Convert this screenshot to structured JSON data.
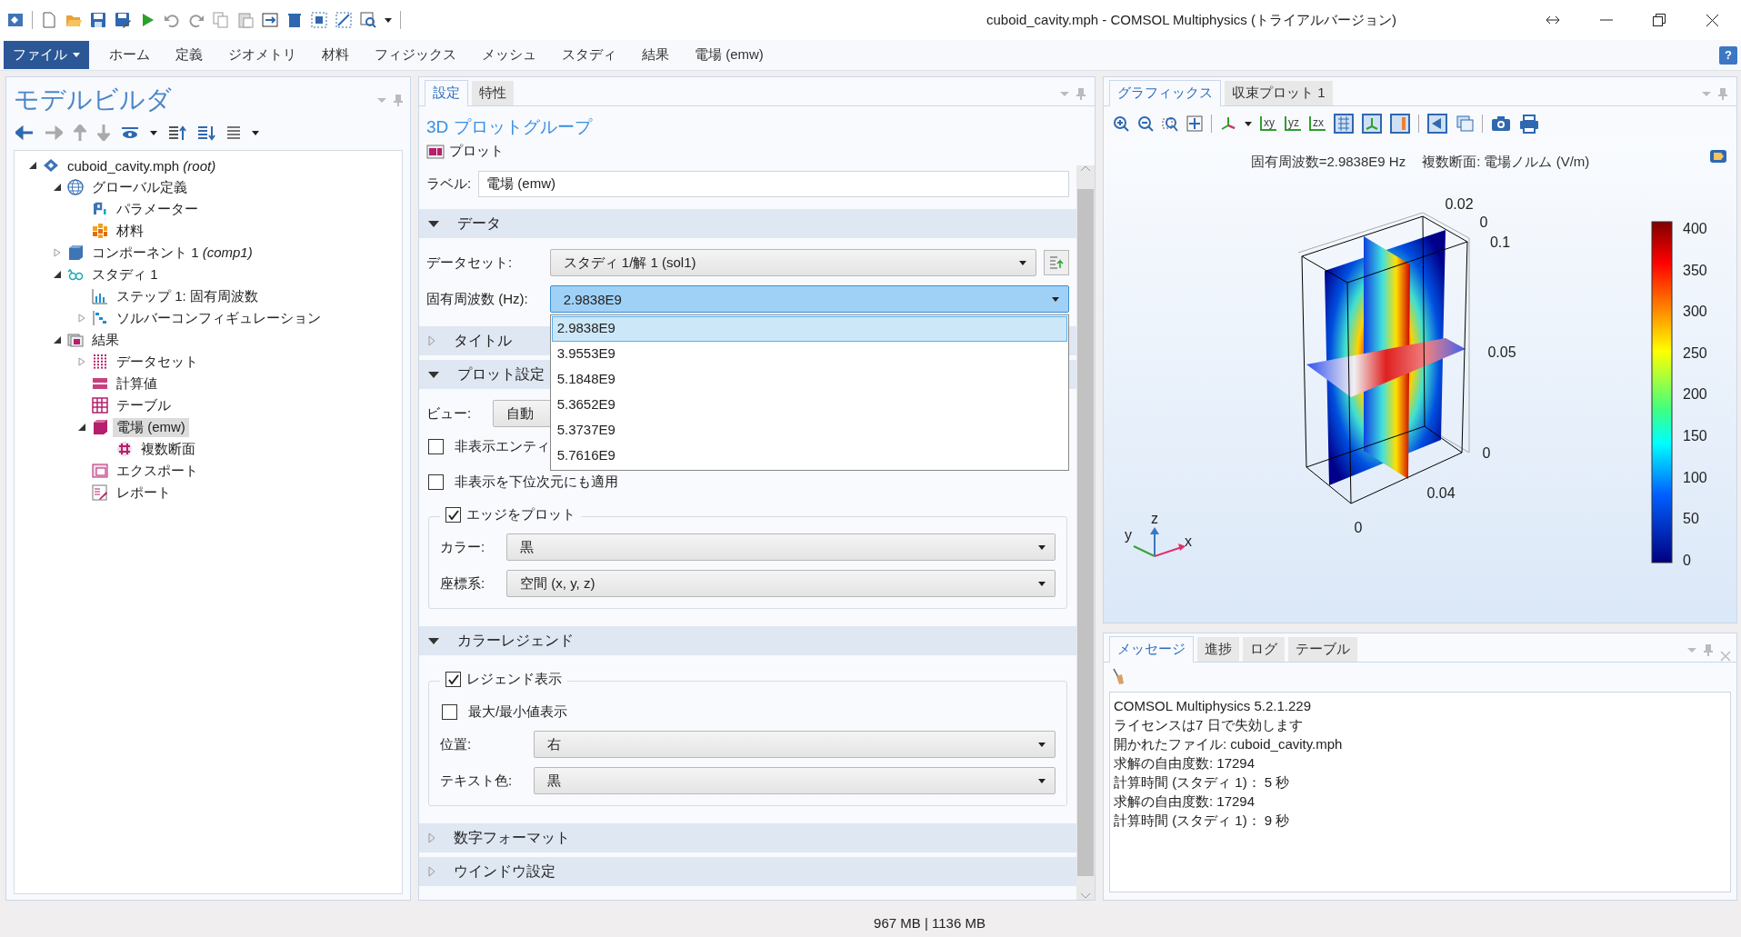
{
  "window": {
    "title": "cuboid_cavity.mph - COMSOL Multiphysics (トライアルバージョン)"
  },
  "menu": [
    {
      "label": "ファイル",
      "kind": "file"
    },
    {
      "label": "ホーム",
      "kind": "tab"
    },
    {
      "label": "定義",
      "kind": "tab"
    },
    {
      "label": "ジオメトリ",
      "kind": "tab"
    },
    {
      "label": "材料",
      "kind": "tab"
    },
    {
      "label": "フィジックス",
      "kind": "tab"
    },
    {
      "label": "メッシュ",
      "kind": "tab"
    },
    {
      "label": "スタディ",
      "kind": "tab"
    },
    {
      "label": "結果",
      "kind": "tab"
    },
    {
      "label": "電場 (emw)",
      "kind": "tab"
    }
  ],
  "help": "?",
  "model_builder": {
    "title": "モデルビルダ",
    "tree": [
      {
        "label": "cuboid_cavity.mph *(root)*",
        "expanded": true,
        "selected": false,
        "children": [
          {
            "label": "グローバル定義",
            "expanded": true,
            "selected": false,
            "children": [
              {
                "label": "パラメーター",
                "selected": false
              },
              {
                "label": "材料",
                "selected": false
              }
            ]
          },
          {
            "label": "コンポーネント 1 *(comp1)*",
            "expanded": false,
            "selected": false
          },
          {
            "label": "スタディ 1",
            "expanded": true,
            "selected": false,
            "children": [
              {
                "label": "ステップ 1: 固有周波数",
                "selected": false
              },
              {
                "label": "ソルバーコンフィギュレーション",
                "expanded": false,
                "selected": false
              }
            ]
          },
          {
            "label": "結果",
            "expanded": true,
            "selected": false,
            "children": [
              {
                "label": "データセット",
                "expanded": false,
                "selected": false
              },
              {
                "label": "計算値",
                "selected": false
              },
              {
                "label": "テーブル",
                "selected": false
              },
              {
                "label": "電場 (emw)",
                "expanded": true,
                "selected": true,
                "children": [
                  {
                    "label": "複数断面",
                    "selected": false
                  }
                ]
              },
              {
                "label": "エクスポート",
                "selected": false
              },
              {
                "label": "レポート",
                "selected": false
              }
            ]
          }
        ]
      }
    ]
  },
  "settings": {
    "tabs": [
      {
        "label": "設定",
        "selected": true
      },
      {
        "label": "特性",
        "selected": false
      }
    ],
    "heading": "3D プロットグループ",
    "plot_button": "プロット",
    "label_field": {
      "label": "ラベル:",
      "value": "電場 (emw)"
    },
    "sections": [
      {
        "title": "データ",
        "expanded": true,
        "rows": [
          {
            "kind": "combo_button",
            "label": "データセット:",
            "value": "スタディ 1/解 1 (sol1)"
          },
          {
            "kind": "combo",
            "label": "固有周波数 (Hz):",
            "value": "2.9838E9",
            "open": true,
            "options": [
              {
                "label": "2.9838E9",
                "selected": true
              },
              {
                "label": "3.9553E9",
                "selected": false
              },
              {
                "label": "5.1848E9",
                "selected": false
              },
              {
                "label": "5.3652E9",
                "selected": false
              },
              {
                "label": "5.3737E9",
                "selected": false
              },
              {
                "label": "5.7616E9",
                "selected": false
              }
            ]
          }
        ]
      },
      {
        "title": "タイトル",
        "expanded": false
      },
      {
        "title": "プロット設定",
        "expanded": true,
        "rows": [
          {
            "kind": "small_combo",
            "label": "ビュー:",
            "value": "自動"
          },
          {
            "kind": "check",
            "label": "非表示エンティ",
            "checked": false
          },
          {
            "kind": "check",
            "label": "非表示を下位次元にも適用",
            "checked": false
          },
          {
            "kind": "group",
            "label": "エッジをプロット",
            "checked": true,
            "rows": [
              {
                "kind": "combo",
                "label": "カラー:",
                "value": "黒"
              },
              {
                "kind": "combo",
                "label": "座標系:",
                "value": "空間 (x, y, z)"
              }
            ]
          }
        ]
      },
      {
        "title": "カラーレジェンド",
        "expanded": true,
        "rows": [
          {
            "kind": "group",
            "label": "レジェンド表示",
            "checked": true,
            "rows": [
              {
                "kind": "check",
                "label": "最大/最小値表示",
                "checked": false
              },
              {
                "kind": "combo",
                "label": "位置:",
                "value": "右"
              },
              {
                "kind": "combo",
                "label": "テキスト色:",
                "value": "黒"
              }
            ]
          }
        ]
      },
      {
        "title": "数字フォーマット",
        "expanded": false
      },
      {
        "title": "ウインドウ設定",
        "expanded": false
      }
    ]
  },
  "graphics": {
    "tabs": [
      {
        "label": "グラフィックス",
        "selected": true
      },
      {
        "label": "収束プロット 1",
        "selected": false
      }
    ],
    "view_buttons": [
      "xy",
      "yz",
      "zx"
    ],
    "plot_title": [
      "固有周波数=2.9838E9 Hz",
      "複数断面: 電場ノルム (V/m)"
    ],
    "axis_ticks": [
      "0.02",
      "0",
      "0.1",
      "0.05",
      "0",
      "0.04",
      "0"
    ],
    "triad": [
      "z",
      "y",
      "x"
    ],
    "legend_ticks": [
      "400",
      "350",
      "300",
      "250",
      "200",
      "150",
      "100",
      "50",
      "0"
    ]
  },
  "messages": {
    "tabs": [
      {
        "label": "メッセージ",
        "selected": true
      },
      {
        "label": "進捗",
        "selected": false
      },
      {
        "label": "ログ",
        "selected": false
      },
      {
        "label": "テーブル",
        "selected": false
      }
    ],
    "lines": [
      "COMSOL Multiphysics 5.2.1.229",
      "ライセンスは7 日で失効します",
      "開かれたファイル: cuboid_cavity.mph",
      "求解の自由度数: 17294",
      "計算時間 (スタディ 1)： 5 秒",
      "求解の自由度数: 17294",
      "計算時間 (スタディ 1)： 9 秒"
    ]
  },
  "status_bar": {
    "memory": "967 MB | 1136 MB"
  }
}
